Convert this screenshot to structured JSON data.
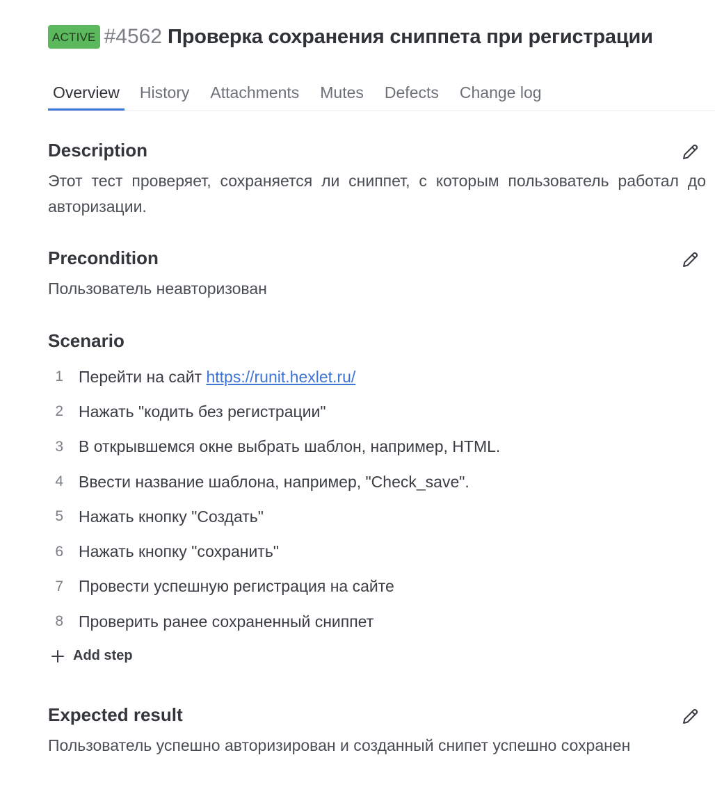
{
  "header": {
    "status": "ACTIVE",
    "status_color": "#5cb85c",
    "case_id": "#4562",
    "title": "Проверка сохранения сниппета при регистрации"
  },
  "tabs": [
    {
      "label": "Overview",
      "active": true
    },
    {
      "label": "History",
      "active": false
    },
    {
      "label": "Attachments",
      "active": false
    },
    {
      "label": "Mutes",
      "active": false
    },
    {
      "label": "Defects",
      "active": false
    },
    {
      "label": "Change log",
      "active": false
    }
  ],
  "description": {
    "title": "Description",
    "text": "Этот тест проверяет, сохраняется ли сниппет, с которым пользователь работал до авторизации.",
    "edit_icon": "pencil-icon"
  },
  "precondition": {
    "title": "Precondition",
    "text": "Пользователь неавторизован",
    "edit_icon": "pencil-icon"
  },
  "scenario": {
    "title": "Scenario",
    "steps": [
      {
        "num": "1",
        "text": "Перейти на сайт ",
        "link": "https://runit.hexlet.ru/"
      },
      {
        "num": "2",
        "text": "Нажать \"кодить без регистрации\""
      },
      {
        "num": "3",
        "text": "В открывшемся окне выбрать шаблон, например, HTML."
      },
      {
        "num": "4",
        "text": "Ввести название шаблона, например, \"Check_save\"."
      },
      {
        "num": "5",
        "text": "Нажать кнопку \"Создать\""
      },
      {
        "num": "6",
        "text": "Нажать кнопку \"сохранить\""
      },
      {
        "num": "7",
        "text": "Провести успешную регистрация на сайте"
      },
      {
        "num": "8",
        "text": "Проверить ранее сохраненный сниппет"
      }
    ],
    "add_step_label": "Add step",
    "add_step_icon": "plus-icon"
  },
  "expected_result": {
    "title": "Expected result",
    "text": "Пользователь успешно авторизирован и созданный снипет успешно сохранен",
    "edit_icon": "pencil-icon"
  },
  "colors": {
    "accent": "#3e74d6",
    "text": "#2f3237",
    "muted": "#6b7079"
  }
}
